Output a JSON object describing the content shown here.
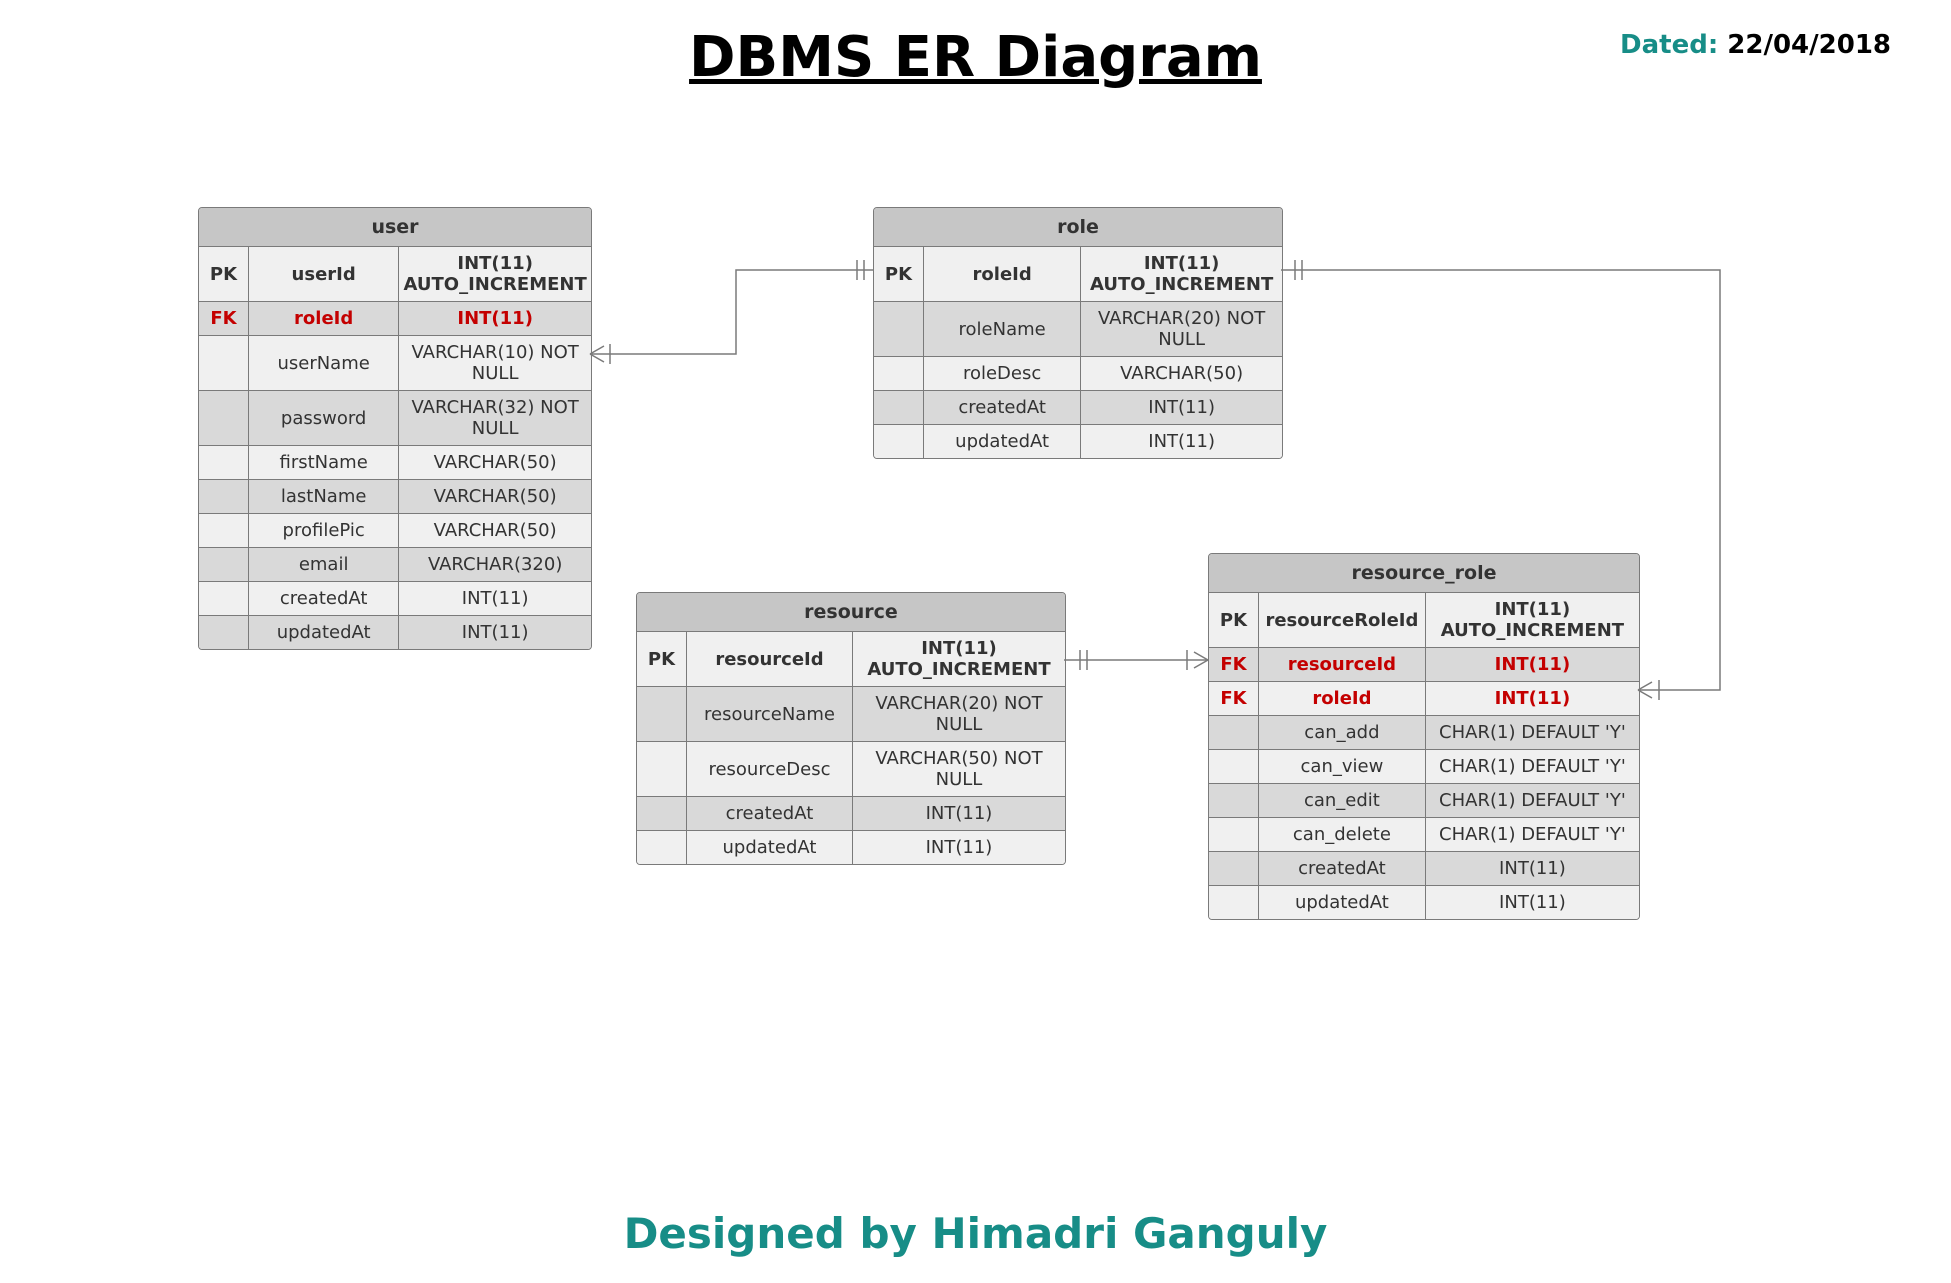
{
  "title": "DBMS ER Diagram",
  "dated_label": "Dated",
  "dated_value": "22/04/2018",
  "footer": "Designed by Himadri Ganguly",
  "entities": {
    "user": {
      "title": "user",
      "rows": [
        {
          "key": "PK",
          "name": "userId",
          "type": "INT(11) AUTO_INCREMENT",
          "kind": "pk"
        },
        {
          "key": "FK",
          "name": "roleId",
          "type": "INT(11)",
          "kind": "fk"
        },
        {
          "key": "",
          "name": "userName",
          "type": "VARCHAR(10) NOT NULL",
          "kind": ""
        },
        {
          "key": "",
          "name": "password",
          "type": "VARCHAR(32) NOT NULL",
          "kind": ""
        },
        {
          "key": "",
          "name": "firstName",
          "type": "VARCHAR(50)",
          "kind": ""
        },
        {
          "key": "",
          "name": "lastName",
          "type": "VARCHAR(50)",
          "kind": ""
        },
        {
          "key": "",
          "name": "profilePic",
          "type": "VARCHAR(50)",
          "kind": ""
        },
        {
          "key": "",
          "name": "email",
          "type": "VARCHAR(320)",
          "kind": ""
        },
        {
          "key": "",
          "name": "createdAt",
          "type": "INT(11)",
          "kind": ""
        },
        {
          "key": "",
          "name": "updatedAt",
          "type": "INT(11)",
          "kind": ""
        }
      ]
    },
    "role": {
      "title": "role",
      "rows": [
        {
          "key": "PK",
          "name": "roleId",
          "type": "INT(11) AUTO_INCREMENT",
          "kind": "pk"
        },
        {
          "key": "",
          "name": "roleName",
          "type": "VARCHAR(20) NOT NULL",
          "kind": ""
        },
        {
          "key": "",
          "name": "roleDesc",
          "type": "VARCHAR(50)",
          "kind": ""
        },
        {
          "key": "",
          "name": "createdAt",
          "type": "INT(11)",
          "kind": ""
        },
        {
          "key": "",
          "name": "updatedAt",
          "type": "INT(11)",
          "kind": ""
        }
      ]
    },
    "resource": {
      "title": "resource",
      "rows": [
        {
          "key": "PK",
          "name": "resourceId",
          "type": "INT(11) AUTO_INCREMENT",
          "kind": "pk"
        },
        {
          "key": "",
          "name": "resourceName",
          "type": "VARCHAR(20) NOT NULL",
          "kind": ""
        },
        {
          "key": "",
          "name": "resourceDesc",
          "type": "VARCHAR(50) NOT NULL",
          "kind": ""
        },
        {
          "key": "",
          "name": "createdAt",
          "type": "INT(11)",
          "kind": ""
        },
        {
          "key": "",
          "name": "updatedAt",
          "type": "INT(11)",
          "kind": ""
        }
      ]
    },
    "resource_role": {
      "title": "resource_role",
      "rows": [
        {
          "key": "PK",
          "name": "resourceRoleId",
          "type": "INT(11) AUTO_INCREMENT",
          "kind": "pk"
        },
        {
          "key": "FK",
          "name": "resourceId",
          "type": "INT(11)",
          "kind": "fk"
        },
        {
          "key": "FK",
          "name": "roleId",
          "type": "INT(11)",
          "kind": "fk"
        },
        {
          "key": "",
          "name": "can_add",
          "type": "CHAR(1) DEFAULT 'Y'",
          "kind": ""
        },
        {
          "key": "",
          "name": "can_view",
          "type": "CHAR(1) DEFAULT 'Y'",
          "kind": ""
        },
        {
          "key": "",
          "name": "can_edit",
          "type": "CHAR(1) DEFAULT 'Y'",
          "kind": ""
        },
        {
          "key": "",
          "name": "can_delete",
          "type": "CHAR(1) DEFAULT 'Y'",
          "kind": ""
        },
        {
          "key": "",
          "name": "createdAt",
          "type": "INT(11)",
          "kind": ""
        },
        {
          "key": "",
          "name": "updatedAt",
          "type": "INT(11)",
          "kind": ""
        }
      ]
    }
  },
  "relationships": [
    {
      "from": "user.roleId",
      "to": "role.roleId",
      "from_card": "many",
      "to_card": "one"
    },
    {
      "from": "resource_role.roleId",
      "to": "role.roleId",
      "from_card": "many",
      "to_card": "one"
    },
    {
      "from": "resource_role.resourceId",
      "to": "resource.resourceId",
      "from_card": "many",
      "to_card": "one"
    }
  ]
}
